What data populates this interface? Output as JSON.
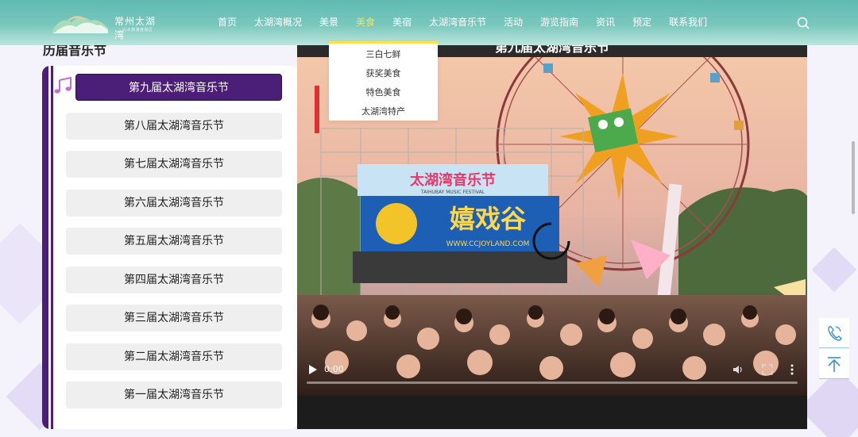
{
  "header": {
    "logo_text": "常州太湖湾",
    "logo_sub": "· 山水旅游度假区 ·",
    "nav": [
      {
        "label": "首页"
      },
      {
        "label": "太湖湾概况"
      },
      {
        "label": "美景"
      },
      {
        "label": "美食",
        "active": true
      },
      {
        "label": "美宿"
      },
      {
        "label": "太湖湾音乐节"
      },
      {
        "label": "活动"
      },
      {
        "label": "游览指南"
      },
      {
        "label": "资讯"
      },
      {
        "label": "预定"
      },
      {
        "label": "联系我们"
      }
    ]
  },
  "dropdown": {
    "items": [
      "三白七鲜",
      "获奖美食",
      "特色美食",
      "太湖湾特产"
    ]
  },
  "section": {
    "title": "历届音乐节"
  },
  "festivals": [
    {
      "label": "第九届太湖湾音乐节",
      "active": true
    },
    {
      "label": "第八届太湖湾音乐节"
    },
    {
      "label": "第七届太湖湾音乐节"
    },
    {
      "label": "第六届太湖湾音乐节"
    },
    {
      "label": "第五届太湖湾音乐节"
    },
    {
      "label": "第四届太湖湾音乐节"
    },
    {
      "label": "第三届太湖湾音乐节"
    },
    {
      "label": "第二届太湖湾音乐节"
    },
    {
      "label": "第一届太湖湾音乐节"
    }
  ],
  "video": {
    "title": "第九届太湖湾音乐节",
    "current_time": "0:00",
    "progress": 0,
    "banner_text": "太湖湾音乐节",
    "banner_sub": "TAIHUBAY MUSIC FESTIVAL",
    "stage_text": "嬉戏谷",
    "stage_url": "WWW.CCJOYLAND.COM"
  },
  "colors": {
    "header": "#5fbab0",
    "nav_active": "#ffe14a",
    "accent_purple": "#4b1f78"
  },
  "icons": [
    "search-icon",
    "music-note-icon",
    "play-icon",
    "volume-icon",
    "fullscreen-icon",
    "more-icon",
    "phone-icon",
    "back-to-top-icon"
  ]
}
